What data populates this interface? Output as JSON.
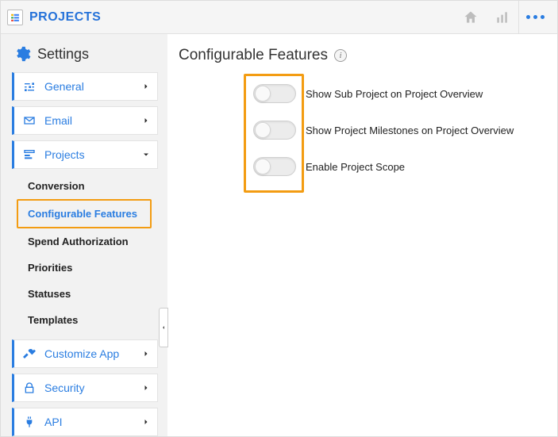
{
  "header": {
    "app_title": "PROJECTS"
  },
  "sidebar": {
    "heading": "Settings",
    "items": [
      {
        "icon": "sliders",
        "label": "General",
        "expanded": false
      },
      {
        "icon": "envelope",
        "label": "Email",
        "expanded": false
      },
      {
        "icon": "project",
        "label": "Projects",
        "expanded": true
      },
      {
        "icon": "tools",
        "label": "Customize App",
        "expanded": false
      },
      {
        "icon": "lock",
        "label": "Security",
        "expanded": false
      },
      {
        "icon": "plug",
        "label": "API",
        "expanded": false
      }
    ],
    "projects_subitems": [
      {
        "label": "Conversion",
        "active": false
      },
      {
        "label": "Configurable Features",
        "active": true
      },
      {
        "label": "Spend Authorization",
        "active": false
      },
      {
        "label": "Priorities",
        "active": false
      },
      {
        "label": "Statuses",
        "active": false
      },
      {
        "label": "Templates",
        "active": false
      }
    ]
  },
  "content": {
    "title": "Configurable Features",
    "toggles": [
      {
        "label": "Show Sub Project on Project Overview",
        "on": false
      },
      {
        "label": "Show Project Milestones on Project Overview",
        "on": false
      },
      {
        "label": "Enable Project Scope",
        "on": false
      }
    ]
  }
}
